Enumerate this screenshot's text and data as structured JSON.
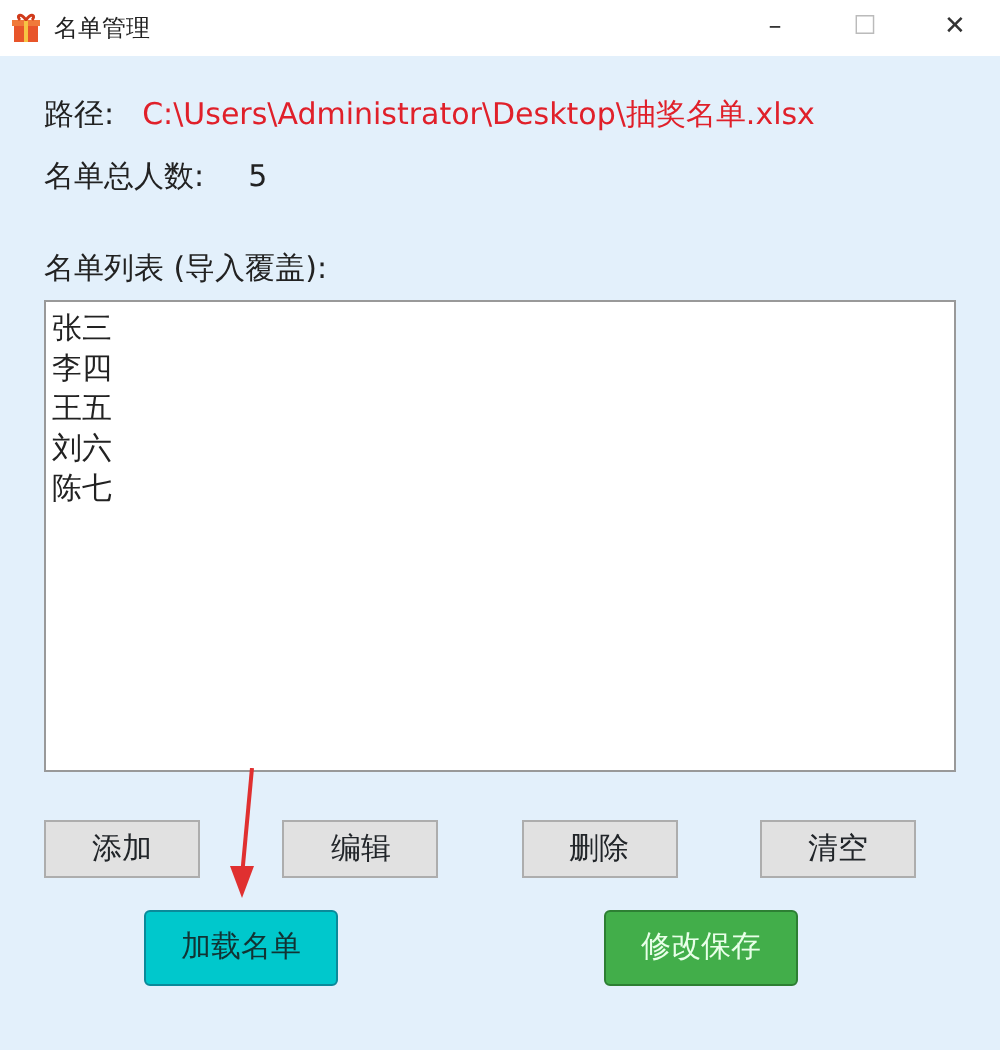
{
  "window": {
    "title": "名单管理",
    "controls": [
      "–",
      "☐",
      "✕"
    ]
  },
  "path": {
    "label": "路径:",
    "value": "C:\\Users\\Administrator\\Desktop\\抽奖名单.xlsx"
  },
  "count": {
    "label": "名单总人数:",
    "value": "5"
  },
  "list": {
    "label": "名单列表 (导入覆盖):",
    "names": [
      "张三",
      "李四",
      "王五",
      "刘六",
      "陈七"
    ]
  },
  "edit_buttons": [
    "添加",
    "编辑",
    "删除",
    "清空"
  ],
  "action_buttons": [
    {
      "label": "加载名单",
      "kind": "load"
    },
    {
      "label": "修改保存",
      "kind": "save"
    }
  ]
}
